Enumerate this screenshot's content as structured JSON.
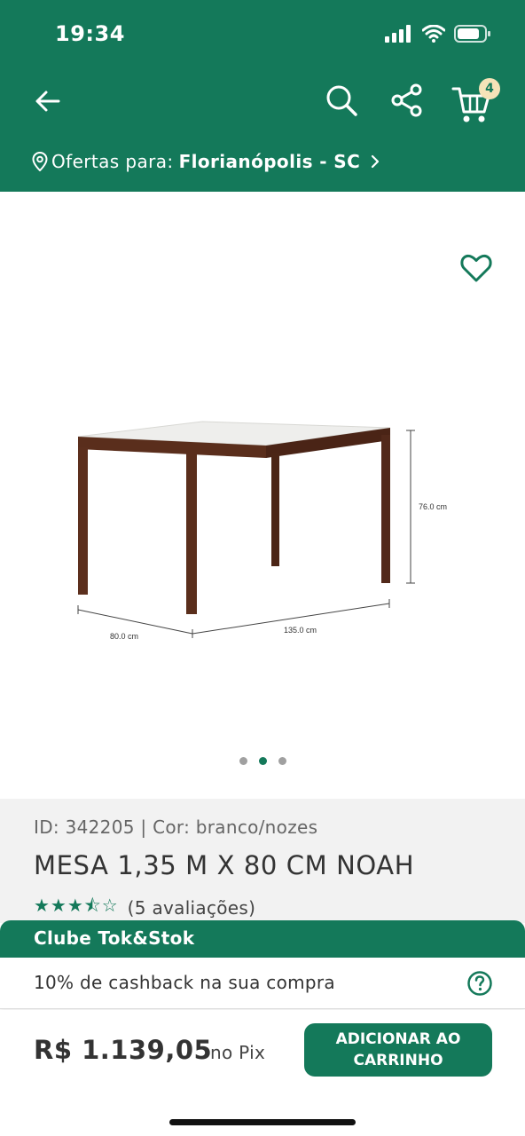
{
  "status_bar": {
    "time": "19:34"
  },
  "nav": {
    "cart_count": "4"
  },
  "location": {
    "label": "Ofertas para:",
    "city": "Florianópolis - SC"
  },
  "product_image": {
    "dimension_height": "76.0 cm",
    "dimension_depth": "80.0 cm",
    "dimension_width": "135.0 cm",
    "carousel_total": 3,
    "carousel_active": 2
  },
  "product": {
    "meta": "ID: 342205 | Cor: branco/nozes",
    "title": "MESA 1,35 M X 80 CM NOAH",
    "stars": "★★★⯪☆",
    "rating_value": 3.5,
    "rating_count": "(5 avaliações)"
  },
  "club": {
    "title": "Clube Tok&Stok",
    "benefit": "10% de cashback na sua compra"
  },
  "footer": {
    "price": "R$ 1.139,05",
    "price_suffix": "no Pix",
    "add_button": "ADICIONAR AO\nCARRINHO"
  },
  "colors": {
    "brand_green": "#14795a",
    "badge_bg": "#f5e3b8",
    "info_bg": "#f2f2f2"
  }
}
